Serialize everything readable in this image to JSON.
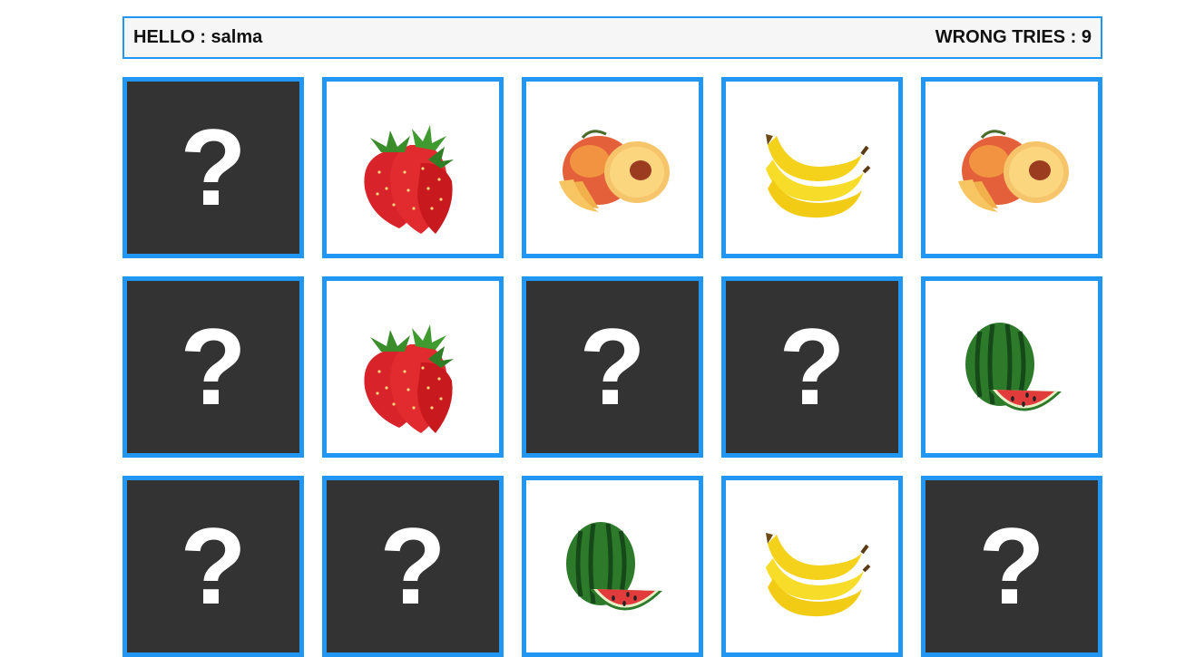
{
  "header": {
    "greeting": "HELLO : salma",
    "wrong_tries": "WRONG TRIES : 9"
  },
  "card_back_symbol": "?",
  "colors": {
    "border": "#2196f3",
    "card_back": "#333333",
    "header_bg": "#f6f6f6"
  },
  "cards": [
    {
      "state": "hidden"
    },
    {
      "state": "revealed",
      "fruit": "strawberry-icon"
    },
    {
      "state": "revealed",
      "fruit": "peach-icon"
    },
    {
      "state": "revealed",
      "fruit": "banana-icon"
    },
    {
      "state": "revealed",
      "fruit": "peach-icon"
    },
    {
      "state": "hidden"
    },
    {
      "state": "revealed",
      "fruit": "strawberry-icon"
    },
    {
      "state": "hidden"
    },
    {
      "state": "hidden"
    },
    {
      "state": "revealed",
      "fruit": "watermelon-icon"
    },
    {
      "state": "hidden"
    },
    {
      "state": "hidden"
    },
    {
      "state": "revealed",
      "fruit": "watermelon-icon"
    },
    {
      "state": "revealed",
      "fruit": "banana-icon"
    },
    {
      "state": "hidden"
    }
  ]
}
